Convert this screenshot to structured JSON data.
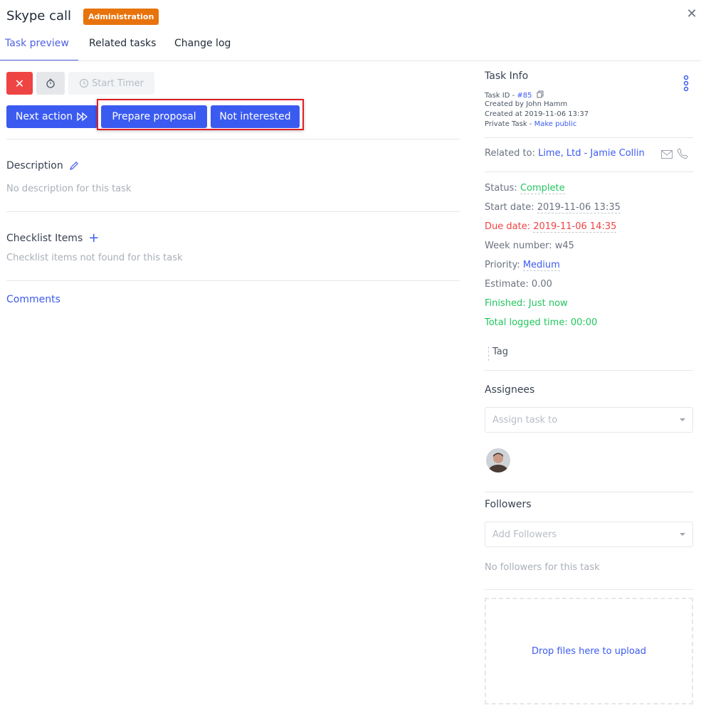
{
  "header": {
    "title": "Skype call",
    "badge": "Administration",
    "close_glyph": "✕"
  },
  "tabs": [
    {
      "label": "Task preview",
      "active": true
    },
    {
      "label": "Related tasks"
    },
    {
      "label": "Change log"
    }
  ],
  "toolbar": {
    "close_glyph": "✕",
    "start_timer_label": "Start Timer",
    "next_action_label": "Next action",
    "prepare_proposal_label": "Prepare proposal",
    "not_interested_label": "Not interested"
  },
  "description": {
    "title": "Description",
    "empty_text": "No description for this task"
  },
  "checklist": {
    "title": "Checklist Items",
    "add_glyph": "+",
    "empty_text": "Checklist items not found for this task"
  },
  "comments_label": "Comments",
  "task_info": {
    "title": "Task Info",
    "task_id_label": "Task ID - ",
    "task_id": "#85",
    "created_by": "Created by John Hamm",
    "created_at": "Created at 2019-11-06 13:37",
    "private_label": "Private Task - ",
    "make_public": "Make public"
  },
  "related": {
    "label": "Related to: ",
    "value": "Lime, Ltd - Jamie Collin"
  },
  "details": {
    "status_label": "Status: ",
    "status_value": "Complete",
    "start_label": "Start date: ",
    "start_value": "2019-11-06 13:35",
    "due_label": "Due date: ",
    "due_value": "2019-11-06 14:35",
    "week": "Week number: w45",
    "priority_label": "Priority: ",
    "priority_value": "Medium",
    "estimate": "Estimate: 0.00",
    "finished": "Finished: Just now",
    "logged": "Total logged time: 00:00"
  },
  "tag_placeholder": "Tag",
  "assignees": {
    "title": "Assignees",
    "placeholder": "Assign task to"
  },
  "followers": {
    "title": "Followers",
    "placeholder": "Add Followers",
    "empty_text": "No followers for this task"
  },
  "dropzone_text": "Drop files here to upload",
  "colors": {
    "primary": "#3b5bf0",
    "danger": "#ef4444",
    "success": "#22c55e",
    "badge": "#e8730c"
  }
}
